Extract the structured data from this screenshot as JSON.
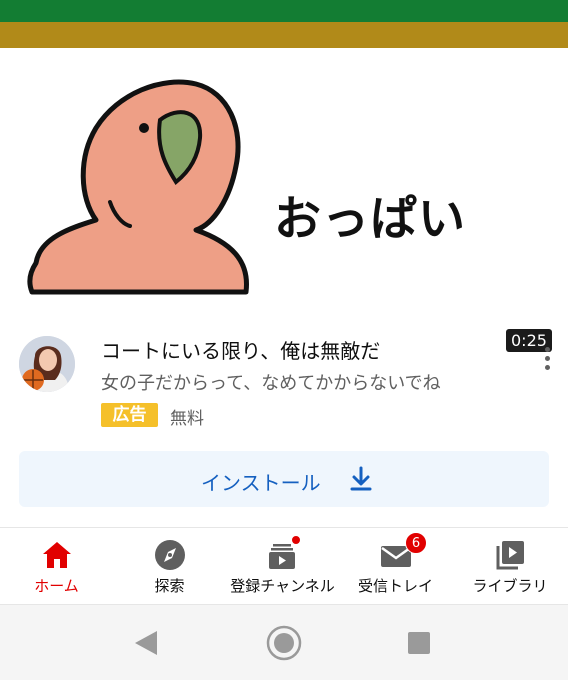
{
  "top_bars": {
    "colors": {
      "green": "#137d33",
      "olive": "#b18a19"
    }
  },
  "thumbnail": {
    "image_text": "おっぱい",
    "duration": "0:25",
    "illustration": "pink-bird-icon"
  },
  "ad": {
    "title": "コートにいる限り、俺は無敵だ",
    "subtitle": "女の子だからって、なめてかからないでね",
    "badge": "広告",
    "price": "無料",
    "menu_icon": "more-vert-icon"
  },
  "install": {
    "label": "インストール",
    "icon": "download-icon"
  },
  "bottom_nav": {
    "items": [
      {
        "label": "ホーム",
        "icon": "home-icon",
        "active": true
      },
      {
        "label": "探索",
        "icon": "compass-icon",
        "active": false
      },
      {
        "label": "登録チャンネル",
        "icon": "subscriptions-icon",
        "active": false,
        "dot": true
      },
      {
        "label": "受信トレイ",
        "icon": "mail-icon",
        "active": false,
        "badge": "6"
      },
      {
        "label": "ライブラリ",
        "icon": "library-icon",
        "active": false
      }
    ]
  },
  "system_nav": {
    "buttons": [
      "back-icon",
      "home-circle-icon",
      "recents-icon"
    ]
  },
  "colors": {
    "accent_red": "#e10000",
    "link_blue": "#1560c0",
    "ad_yellow": "#f5c02a"
  }
}
